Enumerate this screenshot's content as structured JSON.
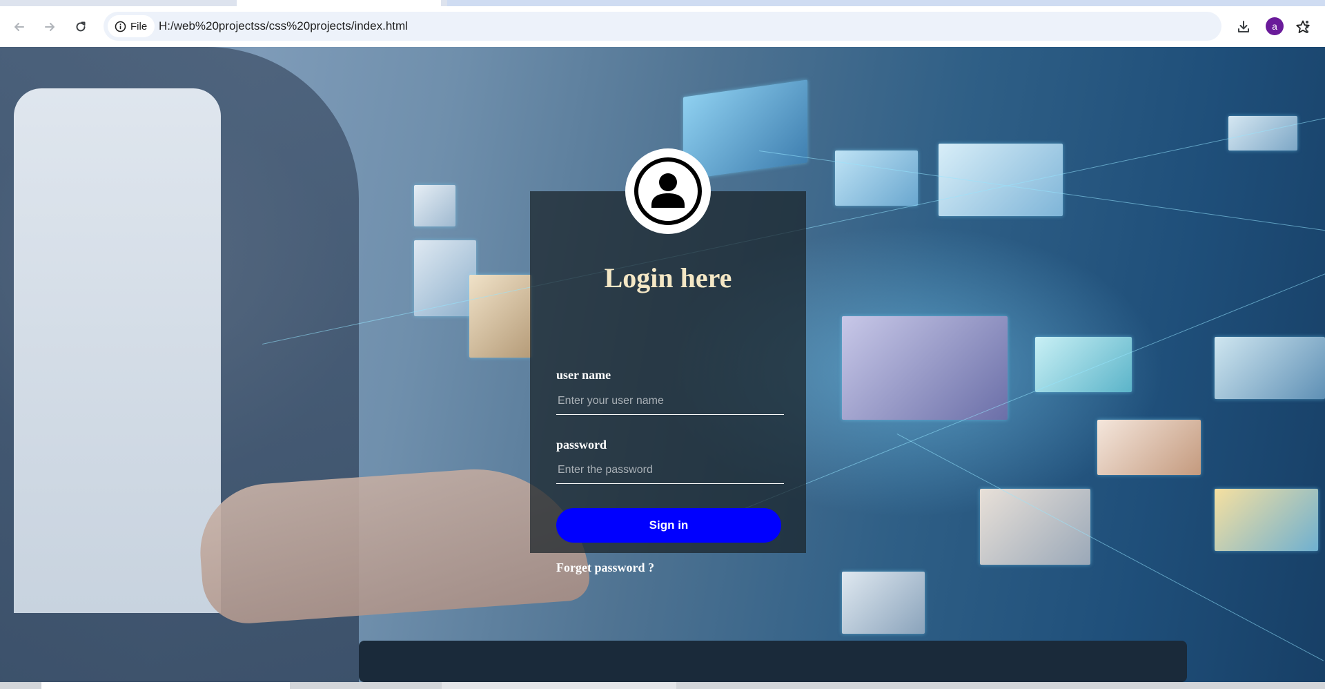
{
  "browser": {
    "site_chip_label": "File",
    "url": "H:/web%20projectss/css%20projects/index.html",
    "profile_initial": "a",
    "profile_color": "#6a1b9a"
  },
  "login": {
    "title": "Login here",
    "username_label": "user name",
    "username_placeholder": "Enter your user name",
    "password_label": "password",
    "password_placeholder": "Enter the password",
    "signin_label": "Sign in",
    "forgot_label": "Forget password ?"
  },
  "colors": {
    "title": "#f4e7c5",
    "button": "#0000ff",
    "card_background": "rgba(25,35,40,0.72)"
  },
  "icons": {
    "back": "arrow-left-icon",
    "forward": "arrow-right-icon",
    "reload": "reload-icon",
    "site_info": "info-icon",
    "bookmark": "star-icon",
    "downloads": "download-icon",
    "menu": "kebab-menu-icon",
    "user": "user-avatar-icon"
  }
}
